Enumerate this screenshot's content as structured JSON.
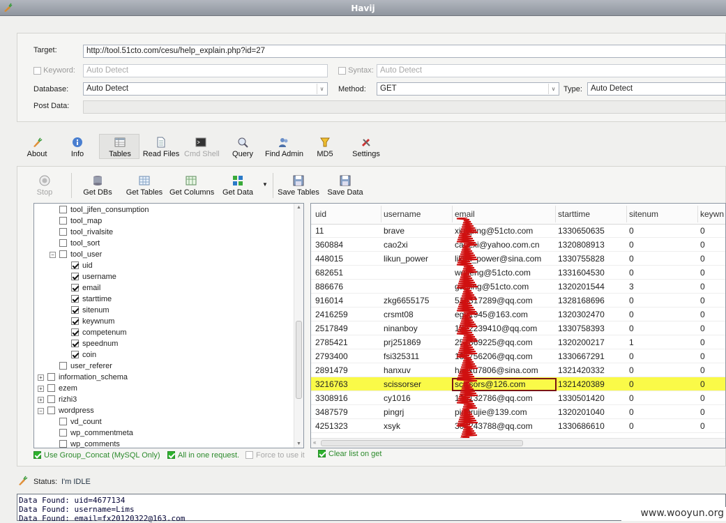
{
  "window": {
    "title": "Havij"
  },
  "target": {
    "target_label": "Target:",
    "target_value": "http://tool.51cto.com/cesu/help_explain.php?id=27",
    "keyword_label": "Keyword:",
    "keyword_placeholder": "Auto Detect",
    "syntax_label": "Syntax:",
    "syntax_placeholder": "Auto Detect",
    "database_label": "Database:",
    "database_value": "Auto Detect",
    "method_label": "Method:",
    "method_value": "GET",
    "type_label": "Type:",
    "type_value": "Auto Detect",
    "postdata_label": "Post Data:"
  },
  "main_toolbar": [
    {
      "label": "About",
      "icon": "carrot-icon"
    },
    {
      "label": "Info",
      "icon": "info-icon"
    },
    {
      "label": "Tables",
      "icon": "table-icon"
    },
    {
      "label": "Read Files",
      "icon": "document-icon"
    },
    {
      "label": "Cmd Shell",
      "icon": "terminal-icon"
    },
    {
      "label": "Query",
      "icon": "query-icon"
    },
    {
      "label": "Find Admin",
      "icon": "users-icon"
    },
    {
      "label": "MD5",
      "icon": "hash-icon"
    },
    {
      "label": "Settings",
      "icon": "tools-icon"
    }
  ],
  "tables_toolbar": {
    "stop_label": "Stop",
    "get_dbs_label": "Get DBs",
    "get_tables_label": "Get Tables",
    "get_columns_label": "Get Columns",
    "get_data_label": "Get Data",
    "save_tables_label": "Save Tables",
    "save_data_label": "Save Data"
  },
  "tree": [
    {
      "label": "tool_jifen_consumption",
      "level": 2,
      "checked": false
    },
    {
      "label": "tool_map",
      "level": 2,
      "checked": false
    },
    {
      "label": "tool_rivalsite",
      "level": 2,
      "checked": false
    },
    {
      "label": "tool_sort",
      "level": 2,
      "checked": false
    },
    {
      "label": "tool_user",
      "level": 2,
      "checked": false,
      "expander": "-"
    },
    {
      "label": "uid",
      "level": 3,
      "checked": true
    },
    {
      "label": "username",
      "level": 3,
      "checked": true
    },
    {
      "label": "email",
      "level": 3,
      "checked": true
    },
    {
      "label": "starttime",
      "level": 3,
      "checked": true
    },
    {
      "label": "sitenum",
      "level": 3,
      "checked": true
    },
    {
      "label": "keywnum",
      "level": 3,
      "checked": true
    },
    {
      "label": "competenum",
      "level": 3,
      "checked": true
    },
    {
      "label": "speednum",
      "level": 3,
      "checked": true
    },
    {
      "label": "coin",
      "level": 3,
      "checked": true
    },
    {
      "label": "user_referer",
      "level": 2,
      "checked": false
    },
    {
      "label": "information_schema",
      "level": 1,
      "checked": false,
      "expander": "+"
    },
    {
      "label": "ezem",
      "level": 1,
      "checked": false,
      "expander": "+"
    },
    {
      "label": "rizhi3",
      "level": 1,
      "checked": false,
      "expander": "+"
    },
    {
      "label": "wordpress",
      "level": 1,
      "checked": false,
      "expander": "-"
    },
    {
      "label": "vd_count",
      "level": 2,
      "checked": false
    },
    {
      "label": "wp_commentmeta",
      "level": 2,
      "checked": false
    },
    {
      "label": "wp_comments",
      "level": 2,
      "checked": false
    }
  ],
  "grid": {
    "columns": [
      "uid",
      "username",
      "email",
      "starttime",
      "sitenum",
      "keywn"
    ],
    "rows": [
      [
        "11",
        "brave",
        "xiaoping@51cto.com",
        "1330650635",
        "0",
        "0"
      ],
      [
        "360884",
        "cao2xi",
        "cao2xi@yahoo.com.cn",
        "1320808913",
        "0",
        "0"
      ],
      [
        "448015",
        "likun_power",
        "likun_power@sina.com",
        "1330755828",
        "0",
        "0"
      ],
      [
        "682651",
        "",
        "weifeng@51cto.com",
        "1331604530",
        "0",
        "0"
      ],
      [
        "886676",
        "",
        "gaoling@51cto.com",
        "1320201544",
        "3",
        "0"
      ],
      [
        "916014",
        "zkg6655175",
        "515317289@qq.com",
        "1328168696",
        "0",
        "0"
      ],
      [
        "2416259",
        "crsmt08",
        "egg1945@163.com",
        "1320302470",
        "0",
        "0"
      ],
      [
        "2517849",
        "ninanboy",
        "1322239410@qq.com",
        "1330758393",
        "0",
        "0"
      ],
      [
        "2785421",
        "prj251869",
        "251869225@qq.com",
        "1320200217",
        "1",
        "0"
      ],
      [
        "2793400",
        "fsi325311",
        "181756206@qq.com",
        "1330667291",
        "0",
        "0"
      ],
      [
        "2891479",
        "hanxuv",
        "hanxu7806@sina.com",
        "1321420332",
        "0",
        "0"
      ],
      [
        "3216763",
        "scissorser",
        "scissors@126.com",
        "1321420389",
        "0",
        "0"
      ],
      [
        "3308916",
        "cy1016",
        "125132786@qq.com",
        "1330501420",
        "0",
        "0"
      ],
      [
        "3487579",
        "pingrj",
        "pingrujie@139.com",
        "1320201040",
        "0",
        "0"
      ],
      [
        "4251323",
        "xsyk",
        "304243788@qq.com",
        "1330686610",
        "0",
        "0"
      ]
    ],
    "selected_row": 11
  },
  "options": {
    "group_concat": "Use Group_Concat (MySQL Only)",
    "all_in_one": "All in one request.",
    "force": "Force to use it",
    "clear_list": "Clear list on get"
  },
  "status": {
    "label": "Status:",
    "value": "I'm IDLE"
  },
  "log": [
    "Data Found: uid=4677134",
    "Data Found: username=Lims",
    "Data Found: email=fx20120322@163.com"
  ],
  "watermark": "www.wooyun.org"
}
